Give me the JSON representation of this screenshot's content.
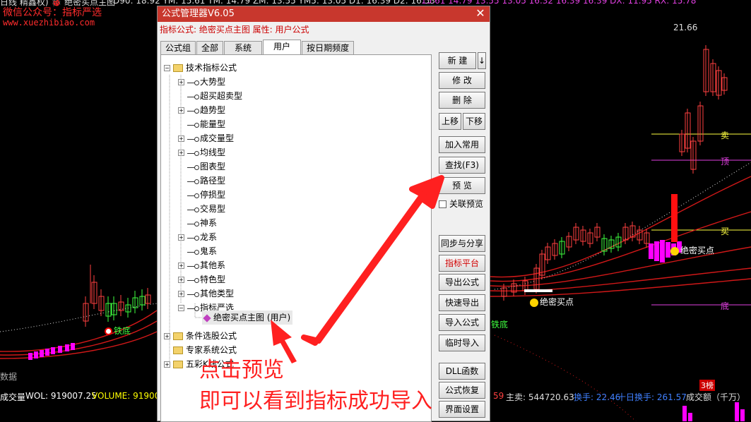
{
  "chart_top": {
    "partial_title": "日线 精鑫权) 🐞 绝密买点主图",
    "ma_values": "D90: 18.92 YM: 15.61 TM: 14.79 ZM: 13.55 YM5: 13.05 D1: 16.39 D2: 16.53",
    "right_values": "15.61 14.79 13.55 13.05 16.32 16.39 16.39 DX: 11.95 RX: 15.78"
  },
  "watermark": {
    "wechat": "微信公众号：指标严选",
    "site": "www.xuezhibiao.com"
  },
  "chart_labels": {
    "price_high": "21.66",
    "sell": "卖",
    "top": "顶",
    "buy": "买",
    "bottom": "底",
    "buy_point_1": "绝密买点",
    "buy_point_2": "绝密买点",
    "iron_bottom_1": "铁底",
    "iron_bottom_2": "铁底",
    "data_label": "数据",
    "dragon": "3榜"
  },
  "bottom_bar": {
    "left_title": "成交量",
    "vol": "WOL: 919007.25",
    "volume": "VOLUME: 91900",
    "right_num": "59",
    "main_sell": "主卖: 544720.63",
    "turnover": "换手: 22.46",
    "ten_day": "十日换手: 261.57",
    "amount": "成交额（千万）"
  },
  "dialog": {
    "title": "公式管理器V6.05",
    "info": "指标公式: 绝密买点主图  属性: 用户公式",
    "close": "✕",
    "tabs": [
      "公式组",
      "全部",
      "系统",
      "用户",
      "按日期频度"
    ]
  },
  "tree": {
    "root": "技术指标公式",
    "children": [
      "大势型",
      "超买超卖型",
      "趋势型",
      "能量型",
      "成交量型",
      "均线型",
      "图表型",
      "路径型",
      "停损型",
      "交易型",
      "神系",
      "龙系",
      "鬼系",
      "其他系",
      "特色型",
      "其他类型",
      "指标严选"
    ],
    "leaf": "绝密买点主图",
    "leaf_tag": "(用户)",
    "others": [
      "条件选股公式",
      "专家系统公式",
      "五彩K线公式"
    ]
  },
  "buttons": {
    "new": "新 建",
    "new_arrow": "↓",
    "edit": "修 改",
    "delete": "删 除",
    "up": "上移",
    "down": "下移",
    "add_common": "加入常用",
    "find": "查找(F3)",
    "preview": "预 览",
    "linked_preview": "关联预览",
    "sync_share": "同步与分享",
    "platform": "指标平台",
    "export": "导出公式",
    "quick_export": "快速导出",
    "import": "导入公式",
    "temp_import": "临时导入",
    "dll": "DLL函数",
    "restore": "公式恢复",
    "ui_settings": "界面设置"
  },
  "annotation": {
    "line1": "点击预览",
    "line2": "即可以看到指标成功导入"
  },
  "colors": {
    "title_bar": "#c8372d",
    "annotation_red": "#ff2020",
    "chart_bg": "#000000"
  }
}
